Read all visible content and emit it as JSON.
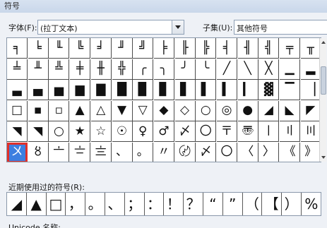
{
  "window": {
    "title": "符号"
  },
  "font_selector": {
    "label": "字体(F):",
    "value": "(拉丁文本)"
  },
  "subset_selector": {
    "label": "子集(U):",
    "value": "其他符号"
  },
  "symbol_grid": {
    "selected_index": 75,
    "rows": [
      [
        "╕",
        "╘",
        "╙",
        "╚",
        "╛",
        "╜",
        "╝",
        "╞",
        "╟",
        "╠",
        "╡",
        "╢",
        "╣",
        "╤",
        "╥"
      ],
      [
        "╧",
        "╨",
        "╩",
        "╪",
        "╫",
        "╬",
        "╭",
        "╮",
        "╯",
        "╰",
        "╱",
        "╲",
        "╳",
        "▁",
        "▂"
      ],
      [
        "▃",
        "▄",
        "▅",
        "▆",
        "▇",
        "█",
        "▉",
        "▊",
        "▋",
        "▌",
        "▍",
        "▎",
        "▓",
        "▔",
        "▕"
      ],
      [
        "□",
        "▪",
        "▫",
        "▲",
        "△",
        "▼",
        "▽",
        "◆",
        "◇",
        "○",
        "◎",
        "●",
        "◢",
        "◣",
        "◤"
      ],
      [
        "◥",
        "◥",
        "○",
        "★",
        "☆",
        "☉",
        "♀",
        "♂",
        "〆",
        "〇",
        "〒",
        "〠",
        "〡",
        "〢",
        "〣"
      ],
      [
        "〤",
        "〥",
        "〦",
        "〧",
        "〨",
        "、",
        "。",
        "〃",
        "〄",
        "〆",
        "〇",
        "〈",
        "〉",
        "《",
        "》"
      ]
    ]
  },
  "recent": {
    "label": "近期使用过的符号(R):",
    "symbols": [
      "◢",
      "▲",
      "□",
      "，",
      "。",
      "、",
      "；",
      "：",
      "！",
      "？",
      "“",
      "”",
      "（",
      "【",
      "）",
      "%"
    ]
  },
  "footer": {
    "partial_label": "Unicode 名称:"
  }
}
